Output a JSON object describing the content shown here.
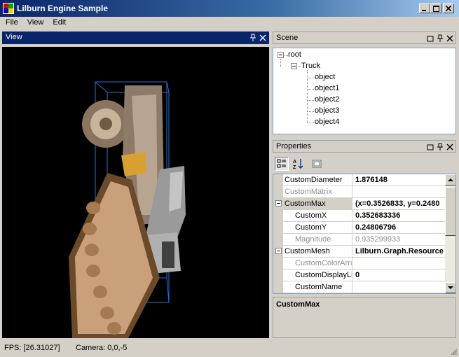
{
  "window": {
    "title": "Lilburn Engine Sample"
  },
  "menu": [
    {
      "label": "File"
    },
    {
      "label": "View"
    },
    {
      "label": "Edit"
    }
  ],
  "view_panel": {
    "title": "View"
  },
  "scene_panel": {
    "title": "Scene",
    "tree": {
      "root": "root",
      "child": "Truck",
      "leaves": [
        "object",
        "object1",
        "object2",
        "object3",
        "object4"
      ]
    }
  },
  "properties_panel": {
    "title": "Properties",
    "toolbar": {
      "categorized_icon": "categorized-icon",
      "alphabetical_icon": "alphabetical-icon",
      "property_pages_icon": "property-pages-icon"
    },
    "rows": [
      {
        "name": "CustomDiameter",
        "value": "1.876148"
      },
      {
        "name": "CustomMatrix",
        "value": ""
      },
      {
        "name": "CustomMax",
        "value": "(x=0.3526833, y=0.2480"
      },
      {
        "name": "CustomX",
        "value": "0.352683336"
      },
      {
        "name": "CustomY",
        "value": "0.24806796"
      },
      {
        "name": "Magnitude",
        "value": "0.935299933"
      },
      {
        "name": "CustomMesh",
        "value": "Lilburn.Graph.Resource"
      },
      {
        "name": "CustomColorArra",
        "value": ""
      },
      {
        "name": "CustomDisplayLis",
        "value": "0"
      },
      {
        "name": "CustomName",
        "value": ""
      }
    ],
    "description": {
      "title": "CustomMax"
    }
  },
  "status": {
    "fps": "FPS: [26.31027]",
    "camera": "Camera: 0,0,-5"
  },
  "colors": {
    "title_bar": "#0a246a",
    "panel_bg": "#d4d0c8",
    "viewport_bg": "#000000",
    "bounding_box": "#2a6fd0"
  }
}
